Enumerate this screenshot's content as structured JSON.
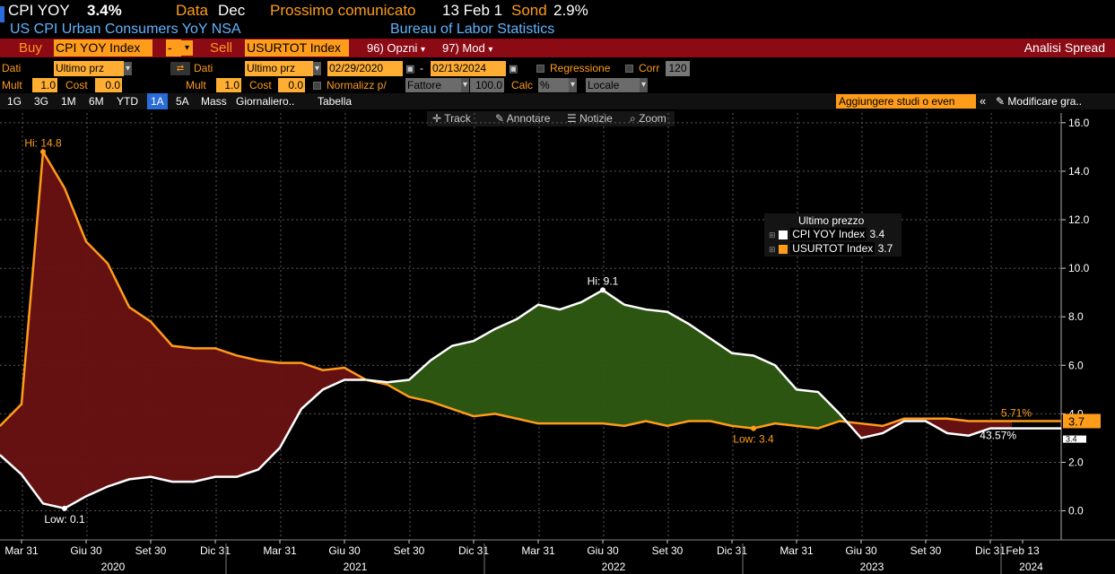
{
  "header": {
    "ticker": "CPI YOY",
    "last_value": "3.4%",
    "data_label": "Data",
    "data_value": "Dec",
    "next_release_label": "Prossimo comunicato",
    "next_release_value": "13 Feb 1",
    "survey_label": "Sond",
    "survey_value": "2.9%",
    "description": "US CPI Urban Consumers YoY NSA",
    "source": "Bureau of Labor Statistics"
  },
  "spread_bar": {
    "buy_label": "Buy",
    "buy_security": "CPI YOY Index",
    "minus": "-",
    "sell_label": "Sell",
    "sell_security": "USURTOT Index",
    "options_label": "96) Opzni",
    "mod_label": "97) Mod",
    "title": "Analisi Spread"
  },
  "controls1": {
    "dati_label": "Dati",
    "dati_value": "Ultimo prz",
    "dati2_label": "Dati",
    "dati2_value": "Ultimo prz",
    "start_date": "02/29/2020",
    "dash": "-",
    "end_date": "02/13/2024",
    "regression_label": "Regressione",
    "corr_label": "Corr",
    "corr_value": "120"
  },
  "controls2": {
    "mult_label": "Mult",
    "mult_value": "1.0",
    "cost_label": "Cost",
    "cost_value": "0.0",
    "mult2_label": "Mult",
    "mult2_value": "1.0",
    "cost2_label": "Cost",
    "cost2_value": "0.0",
    "normalize_label": "Normalizz p/",
    "normalize_value": "Fattore",
    "normalize_number": "100.0",
    "calc_label": "Calc",
    "calc_value": "%",
    "locale_value": "Locale"
  },
  "periods": [
    "1G",
    "3G",
    "1M",
    "6M",
    "YTD",
    "1A",
    "5A",
    "Mass"
  ],
  "active_period": "1A",
  "frequency": "Giornaliero..",
  "table_label": "Tabella",
  "add_studies": "Aggiungere studi o even",
  "modify_label": "Modificare gra..",
  "tools": {
    "track": "Track",
    "annotate": "Annotare",
    "news": "Notizie",
    "zoom": "Zoom"
  },
  "legend": {
    "title": "Ultimo prezzo",
    "items": [
      {
        "name": "CPI YOY Index",
        "value": "3.4",
        "color": "#ffffff"
      },
      {
        "name": "USURTOT Index",
        "value": "3.7",
        "color": "#ff9c1a"
      }
    ]
  },
  "chart_data": {
    "type": "area",
    "x_tick_labels": [
      "Mar 31",
      "Giu 30",
      "Set 30",
      "Dic 31",
      "Mar 31",
      "Giu 30",
      "Set 30",
      "Dic 31",
      "Mar 31",
      "Giu 30",
      "Set 30",
      "Dic 31",
      "Mar 31",
      "Giu 30",
      "Set 30",
      "Dic 31",
      "Feb 13"
    ],
    "year_labels": [
      "2020",
      "2021",
      "2022",
      "2023",
      "2024"
    ],
    "y_ticks": [
      "0.0",
      "2.0",
      "4.0",
      "6.0",
      "8.0",
      "10.0",
      "12.0",
      "14.0",
      "16.0"
    ],
    "ylim": [
      -1.2,
      16.4
    ],
    "grid": true,
    "x": [
      "2020-02",
      "2020-03",
      "2020-04",
      "2020-05",
      "2020-06",
      "2020-07",
      "2020-08",
      "2020-09",
      "2020-10",
      "2020-11",
      "2020-12",
      "2021-01",
      "2021-02",
      "2021-03",
      "2021-04",
      "2021-05",
      "2021-06",
      "2021-07",
      "2021-08",
      "2021-09",
      "2021-10",
      "2021-11",
      "2021-12",
      "2022-01",
      "2022-02",
      "2022-03",
      "2022-04",
      "2022-05",
      "2022-06",
      "2022-07",
      "2022-08",
      "2022-09",
      "2022-10",
      "2022-11",
      "2022-12",
      "2023-01",
      "2023-02",
      "2023-03",
      "2023-04",
      "2023-05",
      "2023-06",
      "2023-07",
      "2023-08",
      "2023-09",
      "2023-10",
      "2023-11",
      "2023-12",
      "2024-01"
    ],
    "series": [
      {
        "name": "CPI YOY Index",
        "color": "#ffffff",
        "values": [
          2.3,
          1.5,
          0.3,
          0.1,
          0.6,
          1.0,
          1.3,
          1.4,
          1.2,
          1.2,
          1.4,
          1.4,
          1.7,
          2.6,
          4.2,
          5.0,
          5.4,
          5.4,
          5.3,
          5.4,
          6.2,
          6.8,
          7.0,
          7.5,
          7.9,
          8.5,
          8.3,
          8.6,
          9.1,
          8.5,
          8.3,
          8.2,
          7.7,
          7.1,
          6.5,
          6.4,
          6.0,
          5.0,
          4.9,
          4.0,
          3.0,
          3.2,
          3.7,
          3.7,
          3.2,
          3.1,
          3.4,
          3.4
        ]
      },
      {
        "name": "USURTOT Index",
        "color": "#ff9c1a",
        "values": [
          3.5,
          4.4,
          14.8,
          13.3,
          11.1,
          10.2,
          8.4,
          7.8,
          6.8,
          6.7,
          6.7,
          6.4,
          6.2,
          6.1,
          6.1,
          5.8,
          5.9,
          5.4,
          5.2,
          4.7,
          4.5,
          4.2,
          3.9,
          4.0,
          3.8,
          3.6,
          3.6,
          3.6,
          3.6,
          3.5,
          3.7,
          3.5,
          3.7,
          3.7,
          3.5,
          3.4,
          3.6,
          3.5,
          3.4,
          3.7,
          3.6,
          3.5,
          3.8,
          3.8,
          3.8,
          3.7,
          3.7,
          3.7
        ]
      }
    ],
    "annotations": {
      "hi_orange": "Hi: 14.8",
      "low_white": "Low: 0.1",
      "hi_white": "Hi: 9.1",
      "low_orange": "Low: 3.4",
      "pct_orange": "5.71%",
      "pct_white": "43.57%",
      "last_orange": "3.7",
      "last_white": "3.4"
    },
    "fill_colors": {
      "orange_above": "#6b1212",
      "white_above": "#2e5a12"
    }
  }
}
